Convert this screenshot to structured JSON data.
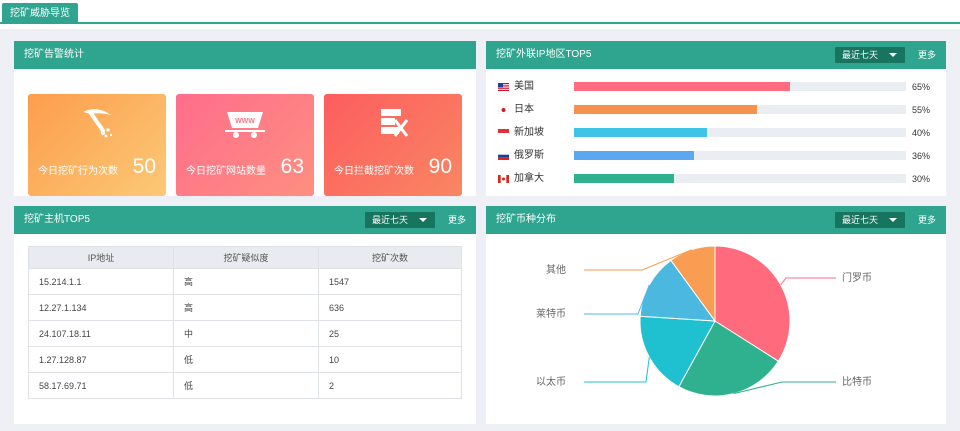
{
  "tab": {
    "label": "挖矿威胁导览"
  },
  "alerts": {
    "title": "挖矿告警统计",
    "cards": [
      {
        "label": "今日挖矿行为次数",
        "value": "50",
        "icon": "pickaxe-icon"
      },
      {
        "label": "今日挖矿网站数量",
        "value": "63",
        "icon": "mine-cart-www-icon"
      },
      {
        "label": "今日拦截挖矿次数",
        "value": "90",
        "icon": "blocked-server-icon"
      }
    ]
  },
  "ip_region": {
    "title": "挖矿外联IP地区TOP5",
    "dropdown": "最近七天",
    "more": "更多",
    "rows": [
      {
        "name": "美国",
        "percent_label": "65%",
        "percent": 65,
        "color": "#ff6b81"
      },
      {
        "name": "日本",
        "percent_label": "55%",
        "percent": 55,
        "color": "#f5924e"
      },
      {
        "name": "新加坡",
        "percent_label": "40%",
        "percent": 40,
        "color": "#3fc4e8"
      },
      {
        "name": "俄罗斯",
        "percent_label": "36%",
        "percent": 36,
        "color": "#5ba8f0"
      },
      {
        "name": "加拿大",
        "percent_label": "30%",
        "percent": 30,
        "color": "#2fb08e"
      }
    ]
  },
  "hosts": {
    "title": "挖矿主机TOP5",
    "dropdown": "最近七天",
    "more": "更多",
    "columns": [
      "IP地址",
      "挖矿疑似度",
      "挖矿次数"
    ],
    "rows": [
      [
        "15.214.1.1",
        "高",
        "1547"
      ],
      [
        "12.27.1.134",
        "高",
        "636"
      ],
      [
        "24.107.18.11",
        "中",
        "25"
      ],
      [
        "1.27.128.87",
        "低",
        "10"
      ],
      [
        "58.17.69.71",
        "低",
        "2"
      ]
    ]
  },
  "coins": {
    "title": "挖矿币种分布",
    "dropdown": "最近七天",
    "more": "更多",
    "chart_data": {
      "type": "pie",
      "slices": [
        {
          "name": "门罗币",
          "value": 34,
          "color": "#ff6b7d"
        },
        {
          "name": "比特币",
          "value": 24,
          "color": "#2fb08e"
        },
        {
          "name": "以太币",
          "value": 18,
          "color": "#1fc0cf"
        },
        {
          "name": "莱特币",
          "value": 14,
          "color": "#4bb8e0"
        },
        {
          "name": "其他",
          "value": 10,
          "color": "#f99d52"
        }
      ]
    }
  }
}
